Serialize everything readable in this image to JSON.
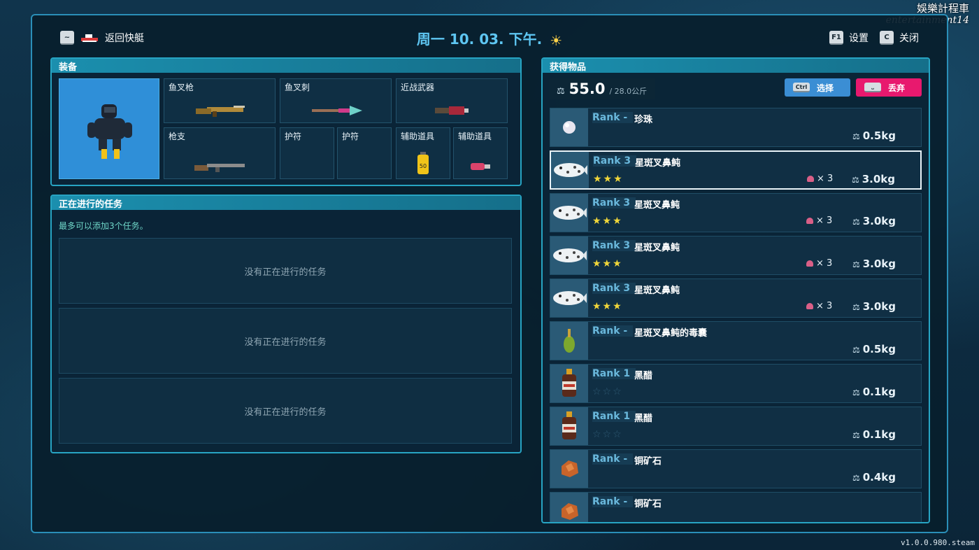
{
  "watermark": {
    "line1": "娛樂計程車",
    "line2": "entertainment14"
  },
  "version": "v1.0.0.980.steam",
  "topbar": {
    "back_key": "~",
    "back_label": "返回快艇",
    "date": "周一 10. 03. 下午.",
    "weather_icon": "sun-icon",
    "settings_key": "F1",
    "settings_label": "设置",
    "close_key": "C",
    "close_label": "关闭"
  },
  "equipment": {
    "title": "装备",
    "slots": [
      {
        "label": "鱼叉枪",
        "icon": "harpoon-gun-icon"
      },
      {
        "label": "鱼叉刺",
        "icon": "harpoon-tip-icon"
      },
      {
        "label": "近战武器",
        "icon": "melee-weapon-icon"
      },
      {
        "label": "枪支",
        "icon": "rifle-icon"
      },
      {
        "label": "护符",
        "icon": ""
      },
      {
        "label": "护符",
        "icon": ""
      },
      {
        "label": "辅助道具",
        "icon": "oxygen-tank-icon",
        "badge": "50"
      },
      {
        "label": "辅助道具",
        "icon": "tool-icon"
      }
    ]
  },
  "tasks": {
    "title": "正在进行的任务",
    "note": "最多可以添加3个任务。",
    "empty_rows": [
      "没有正在进行的任务",
      "没有正在进行的任务",
      "没有正在进行的任务"
    ]
  },
  "inventory": {
    "title": "获得物品",
    "weight_current": "55.0",
    "weight_capacity": "/ 28.0公斤",
    "select_key": "Ctrl",
    "select_label": "选择",
    "drop_key": "⎵",
    "drop_label": "丢弃",
    "items": [
      {
        "rank": "Rank -",
        "name": "珍珠",
        "stars": "",
        "count": "",
        "weight": "0.5kg",
        "icon": "pearl-icon",
        "selected": false
      },
      {
        "rank": "Rank 3",
        "name": "星斑叉鼻鲀",
        "stars": "★★★",
        "count": "× 3",
        "weight": "3.0kg",
        "icon": "pufferfish-icon",
        "selected": true
      },
      {
        "rank": "Rank 3",
        "name": "星斑叉鼻鲀",
        "stars": "★★★",
        "count": "× 3",
        "weight": "3.0kg",
        "icon": "pufferfish-icon",
        "selected": false
      },
      {
        "rank": "Rank 3",
        "name": "星斑叉鼻鲀",
        "stars": "★★★",
        "count": "× 3",
        "weight": "3.0kg",
        "icon": "pufferfish-icon",
        "selected": false
      },
      {
        "rank": "Rank 3",
        "name": "星斑叉鼻鲀",
        "stars": "★★★",
        "count": "× 3",
        "weight": "3.0kg",
        "icon": "pufferfish-icon",
        "selected": false
      },
      {
        "rank": "Rank -",
        "name": "星斑叉鼻鲀的毒囊",
        "stars": "",
        "count": "",
        "weight": "0.5kg",
        "icon": "poison-sac-icon",
        "selected": false
      },
      {
        "rank": "Rank 1",
        "name": "黑醋",
        "stars": "☆☆☆",
        "count": "",
        "weight": "0.1kg",
        "icon": "vinegar-bottle-icon",
        "selected": false
      },
      {
        "rank": "Rank 1",
        "name": "黑醋",
        "stars": "☆☆☆",
        "count": "",
        "weight": "0.1kg",
        "icon": "vinegar-bottle-icon",
        "selected": false
      },
      {
        "rank": "Rank -",
        "name": "铜矿石",
        "stars": "",
        "count": "",
        "weight": "0.4kg",
        "icon": "copper-ore-icon",
        "selected": false
      },
      {
        "rank": "Rank -",
        "name": "铜矿石",
        "stars": "",
        "count": "",
        "weight": "",
        "icon": "copper-ore-icon",
        "selected": false
      }
    ]
  }
}
